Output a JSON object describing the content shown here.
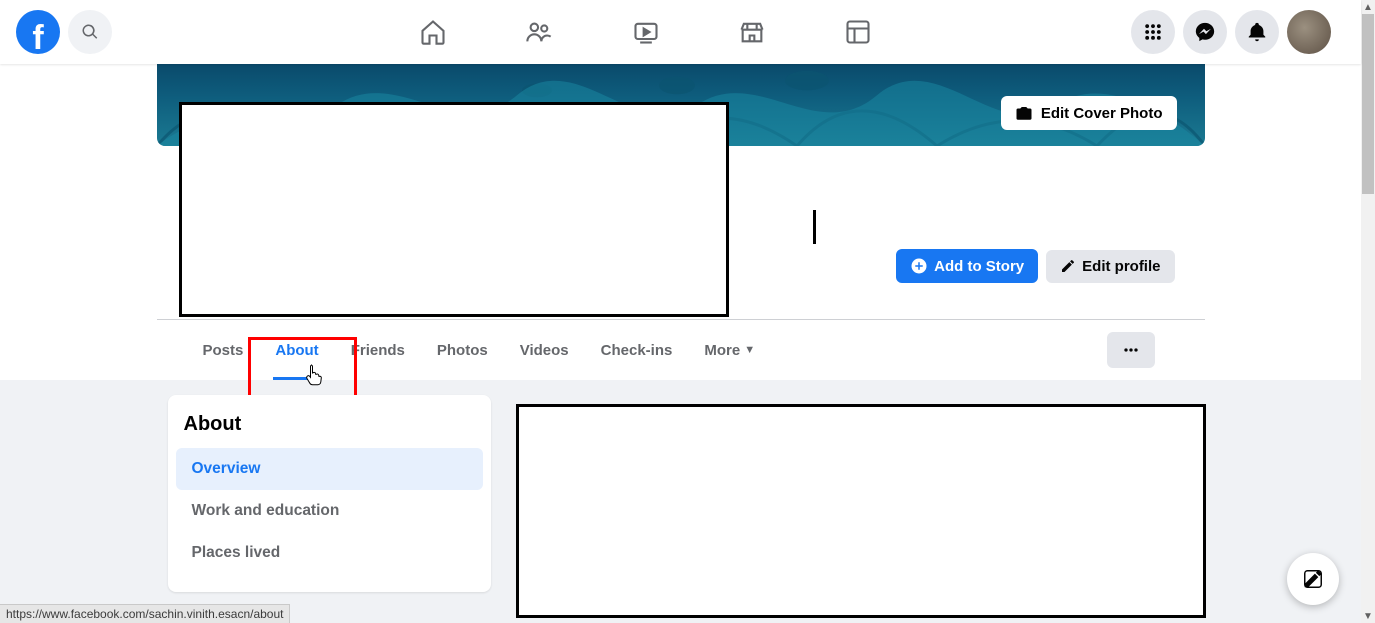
{
  "topnav": {
    "center_items": [
      "home",
      "friends",
      "watch",
      "marketplace",
      "groups"
    ],
    "right_items": [
      "menu",
      "messenger",
      "notifications"
    ]
  },
  "cover": {
    "edit_label": "Edit Cover Photo"
  },
  "profile_actions": {
    "add_to_story": "Add to Story",
    "edit_profile": "Edit profile"
  },
  "tabs": {
    "items": [
      {
        "label": "Posts",
        "active": false
      },
      {
        "label": "About",
        "active": true
      },
      {
        "label": "Friends",
        "active": false
      },
      {
        "label": "Photos",
        "active": false
      },
      {
        "label": "Videos",
        "active": false
      },
      {
        "label": "Check-ins",
        "active": false
      }
    ],
    "more_label": "More"
  },
  "about": {
    "title": "About",
    "items": [
      {
        "label": "Overview",
        "active": true
      },
      {
        "label": "Work and education",
        "active": false
      },
      {
        "label": "Places lived",
        "active": false
      }
    ]
  },
  "status_url": "https://www.facebook.com/sachin.vinith.esacn/about"
}
